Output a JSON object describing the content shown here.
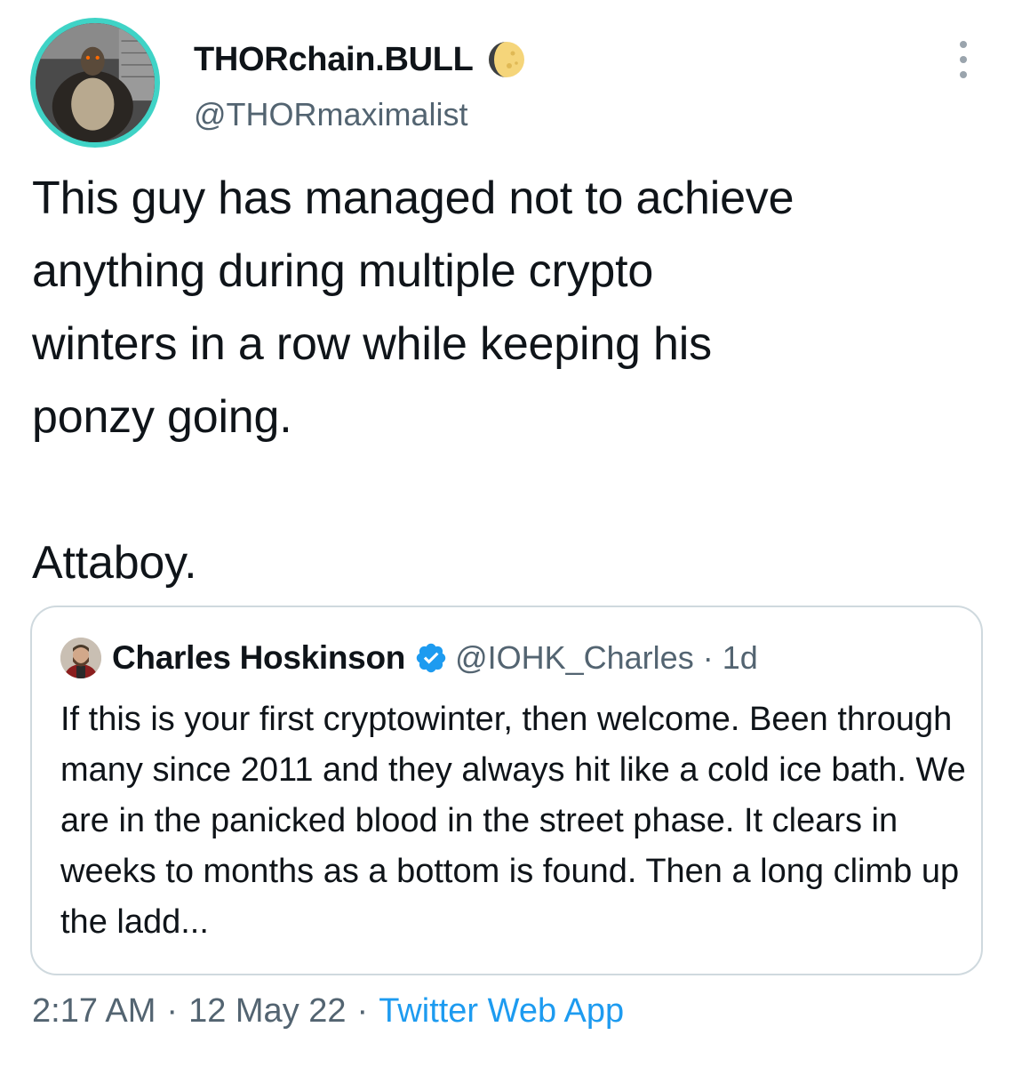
{
  "author": {
    "display_name": "THORchain.BULL",
    "handle": "@THORmaximalist",
    "badge_icon": "crescent-moon-icon"
  },
  "tweet": {
    "text": "This guy has managed not to achieve\nanything during multiple crypto\nwinters in a row while keeping his\nponzy going.\n\nAttaboy."
  },
  "quoted_tweet": {
    "display_name": "Charles Hoskinson",
    "verified_icon": "verified-badge-icon",
    "handle": "@IOHK_Charles",
    "separator": "·",
    "time": "1d",
    "text": "If this is your first cryptowinter, then welcome. Been through many since 2011 and they always hit like a cold ice bath. We are in the panicked blood in the street phase. It clears in weeks to months as a bottom is found. Then a long climb up the ladd..."
  },
  "meta": {
    "time": "2:17 AM",
    "separator": "·",
    "date": "12 May 22",
    "source": "Twitter Web App"
  },
  "colors": {
    "text_primary": "#0f1419",
    "text_secondary": "#536471",
    "link": "#1d9bf0",
    "border": "#cfd9de",
    "avatar_ring": "#3fd3c6"
  }
}
